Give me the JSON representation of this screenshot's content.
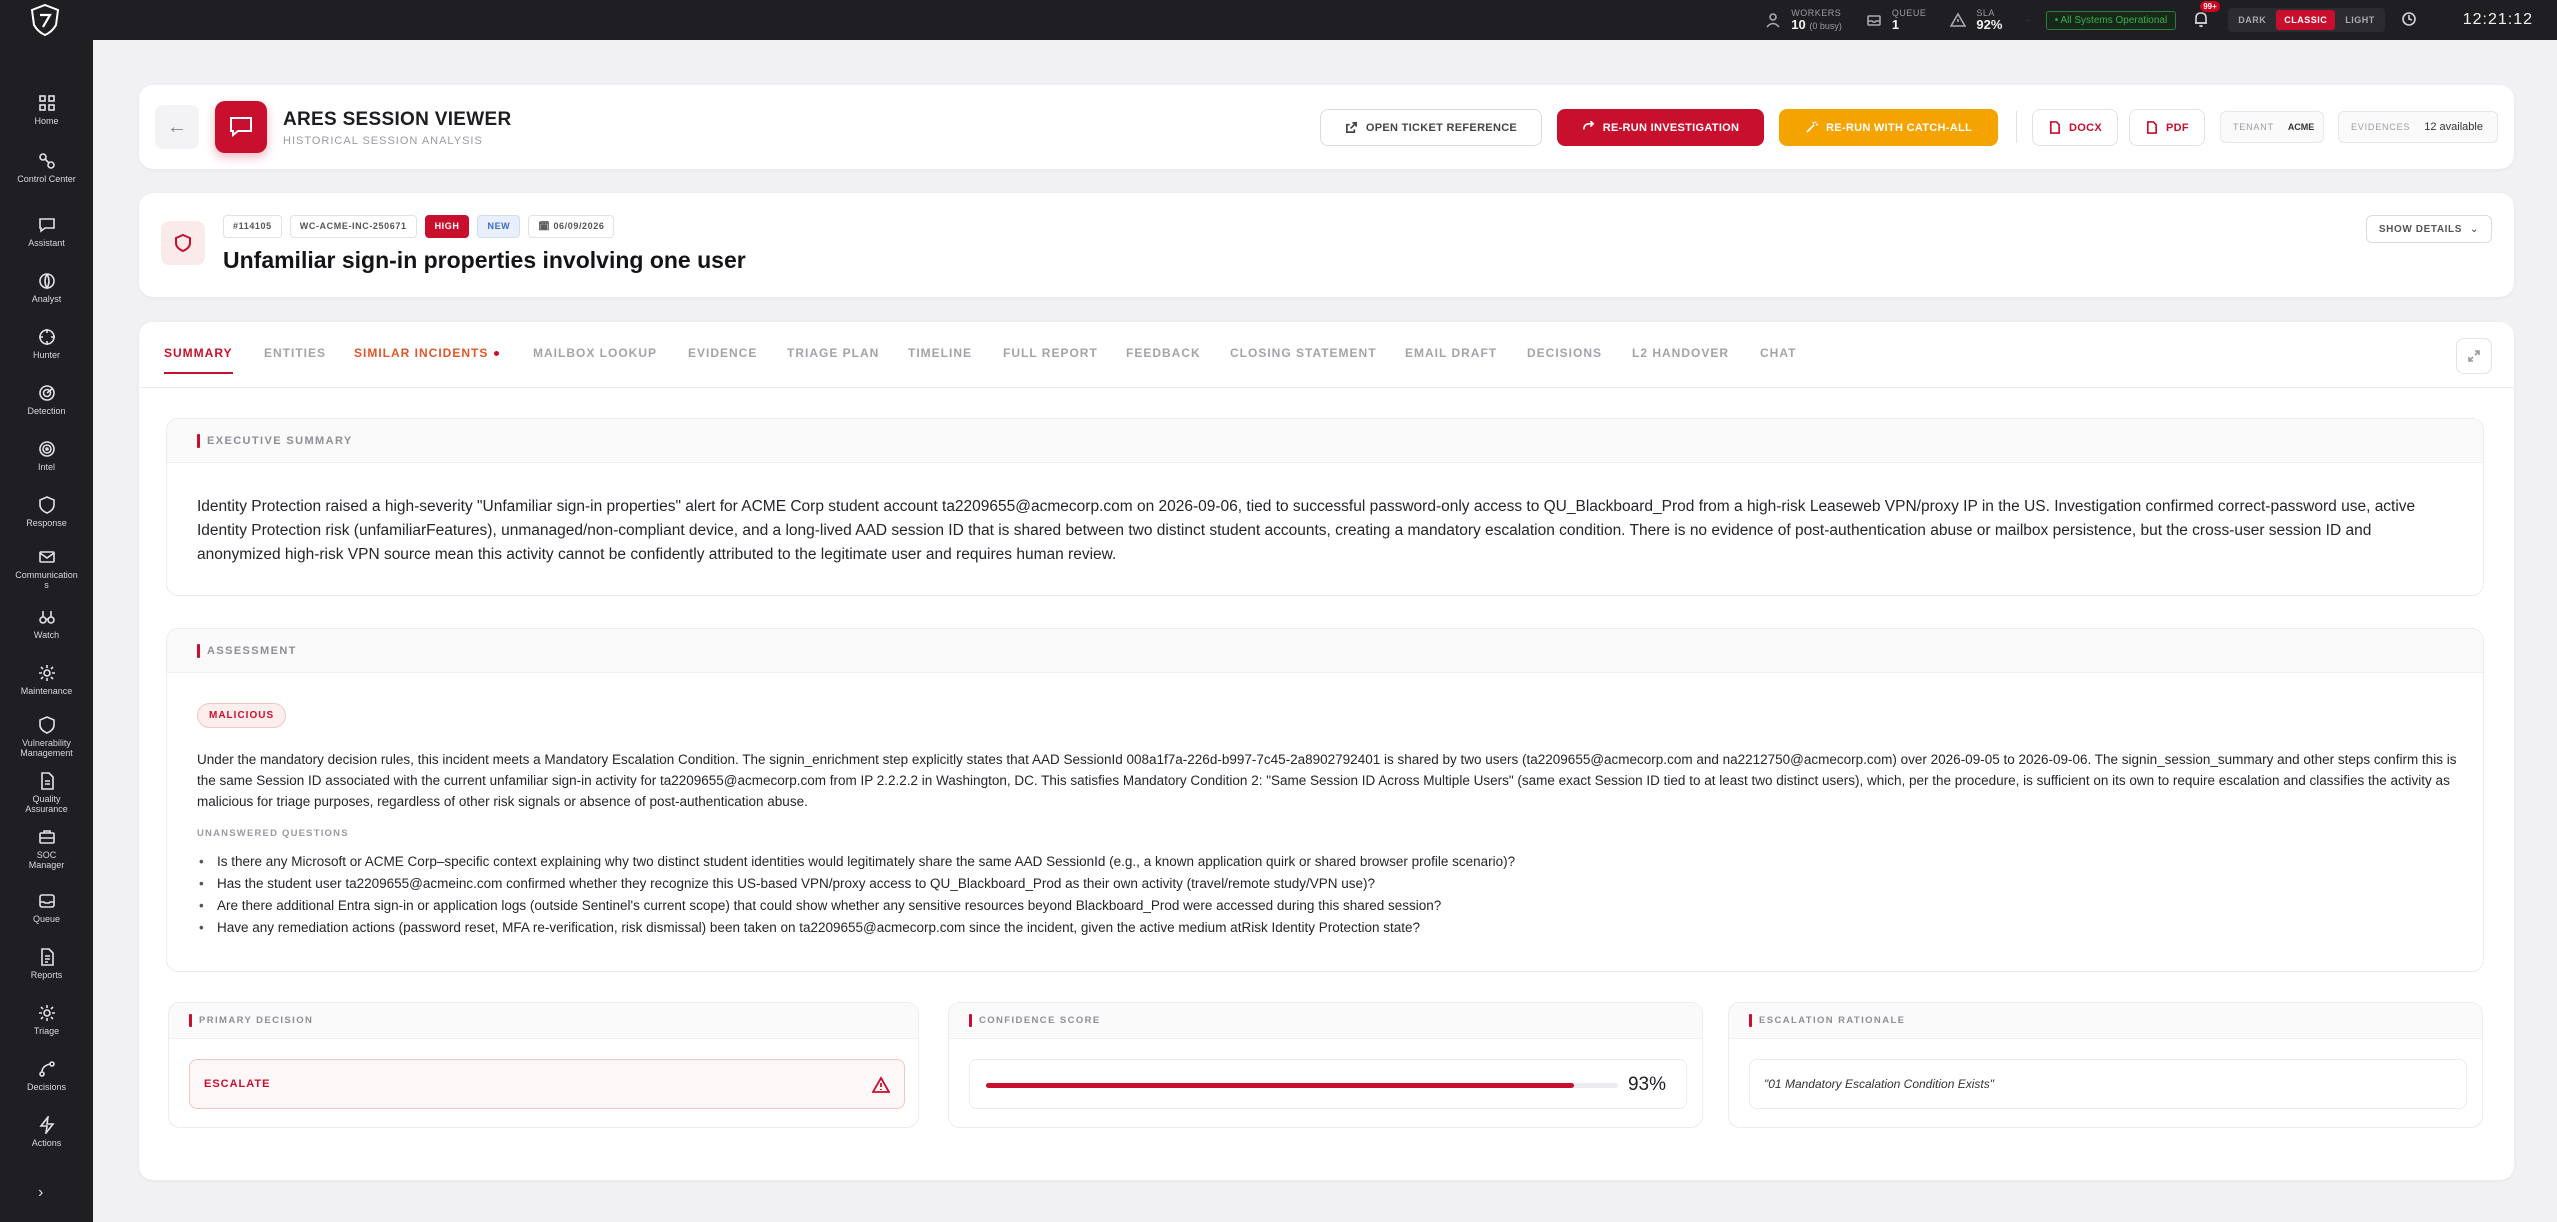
{
  "topbar": {
    "workers_label": "WORKERS",
    "workers_value": "10",
    "workers_sub": "(0 busy)",
    "queue_label": "QUEUE",
    "queue_value": "1",
    "sla_label": "SLA",
    "sla_value": "92%",
    "system_status": "• All Systems Operational",
    "notif_badge": "99+",
    "modes": [
      "DARK",
      "CLASSIC",
      "LIGHT"
    ],
    "clock": "12:21:12"
  },
  "sidebar": {
    "items": [
      {
        "label": "Home",
        "icon": "grid-icon"
      },
      {
        "label": "Control Center",
        "icon": "control-icon"
      },
      {
        "label": "Assistant",
        "icon": "chat-icon"
      },
      {
        "label": "Analyst",
        "icon": "analyst-icon"
      },
      {
        "label": "Hunter",
        "icon": "crosshair-icon"
      },
      {
        "label": "Detection",
        "icon": "radar-icon"
      },
      {
        "label": "Intel",
        "icon": "target-icon"
      },
      {
        "label": "Response",
        "icon": "shield-icon"
      },
      {
        "label": "Communications",
        "icon": "mail-icon"
      },
      {
        "label": "Watch",
        "icon": "binoculars-icon"
      },
      {
        "label": "Maintenance",
        "icon": "gear-icon"
      },
      {
        "label": "Vulnerability Management",
        "icon": "shield-icon"
      },
      {
        "label": "Quality Assurance",
        "icon": "doc-icon"
      },
      {
        "label": "SOC Manager",
        "icon": "briefcase-icon"
      },
      {
        "label": "Queue",
        "icon": "inbox-icon"
      },
      {
        "label": "Reports",
        "icon": "report-icon"
      },
      {
        "label": "Triage",
        "icon": "gear-icon"
      },
      {
        "label": "Decisions",
        "icon": "branch-icon"
      },
      {
        "label": "Actions",
        "icon": "bolt-icon"
      }
    ],
    "expand": "›"
  },
  "header": {
    "back": "←",
    "title": "ARES SESSION VIEWER",
    "subtitle": "HISTORICAL SESSION ANALYSIS",
    "open_ticket": "OPEN TICKET REFERENCE",
    "rerun": "RE-RUN INVESTIGATION",
    "rerun_catch": "RE-RUN WITH CATCH-ALL",
    "docx": "DOCX",
    "pdf": "PDF",
    "tenant_label": "TENANT",
    "tenant_value": "ACME",
    "evidences_label": "EVIDENCES",
    "evidences_value": "12 available"
  },
  "incident": {
    "id": "#114105",
    "ref": "WC-ACME-INC-250671",
    "severity": "HIGH",
    "status": "NEW",
    "date": "06/09/2026",
    "title": "Unfamiliar sign-in properties involving one user",
    "show_details": "SHOW DETAILS"
  },
  "tabs": [
    "SUMMARY",
    "ENTITIES",
    "SIMILAR INCIDENTS",
    "MAILBOX LOOKUP",
    "EVIDENCE",
    "TRIAGE PLAN",
    "TIMELINE",
    "FULL REPORT",
    "FEEDBACK",
    "CLOSING STATEMENT",
    "EMAIL DRAFT",
    "DECISIONS",
    "L2 HANDOVER",
    "CHAT"
  ],
  "executive_summary": {
    "heading": "EXECUTIVE SUMMARY",
    "text": "Identity Protection raised a high-severity \"Unfamiliar sign-in properties\" alert for ACME Corp student account ta2209655@acmecorp.com on 2026-09-06, tied to successful password-only access to QU_Blackboard_Prod from a high-risk Leaseweb VPN/proxy IP in the US. Investigation confirmed correct-password use, active Identity Protection risk (unfamiliarFeatures), unmanaged/non-compliant device, and a long-lived AAD session ID that is shared between two distinct student accounts, creating a mandatory escalation condition. There is no evidence of post-authentication abuse or mailbox persistence, but the cross-user session ID and anonymized high-risk VPN source mean this activity cannot be confidently attributed to the legitimate user and requires human review."
  },
  "assessment": {
    "heading": "ASSESSMENT",
    "verdict": "MALICIOUS",
    "text": "Under the mandatory decision rules, this incident meets a Mandatory Escalation Condition. The signin_enrichment step explicitly states that AAD SessionId 008a1f7a-226d-b997-7c45-2a8902792401 is shared by two users (ta2209655@acmecorp.com and na2212750@acmecorp.com) over 2026-09-05 to 2026-09-06. The signin_session_summary and other steps confirm this is the same Session ID associated with the current unfamiliar sign-in activity for ta2209655@acmecorp.com from IP 2.2.2.2 in Washington, DC. This satisfies Mandatory Condition 2: \"Same Session ID Across Multiple Users\" (same exact Session ID tied to at least two distinct users), which, per the procedure, is sufficient on its own to require escalation and classifies the activity as malicious for triage purposes, regardless of other risk signals or absence of post-authentication abuse.",
    "questions_heading": "UNANSWERED QUESTIONS",
    "questions": [
      "Is there any Microsoft or ACME Corp–specific context explaining why two distinct student identities would legitimately share the same AAD SessionId (e.g., a known application quirk or shared browser profile scenario)?",
      "Has the student user ta2209655@acmeinc.com confirmed whether they recognize this US-based VPN/proxy access to QU_Blackboard_Prod as their own activity (travel/remote study/VPN use)?",
      "Are there additional Entra sign-in or application logs (outside Sentinel's current scope) that could show whether any sensitive resources beyond Blackboard_Prod were accessed during this shared session?",
      "Have any remediation actions (password reset, MFA re-verification, risk dismissal) been taken on ta2209655@acmecorp.com since the incident, given the active medium atRisk Identity Protection state?"
    ]
  },
  "decision": {
    "primary_heading": "PRIMARY DECISION",
    "primary_value": "ESCALATE",
    "confidence_heading": "CONFIDENCE SCORE",
    "confidence_value": "93%",
    "confidence_fraction": 0.93,
    "rationale_heading": "ESCALATION RATIONALE",
    "rationale_value": "\"01 Mandatory Escalation Condition Exists\""
  }
}
